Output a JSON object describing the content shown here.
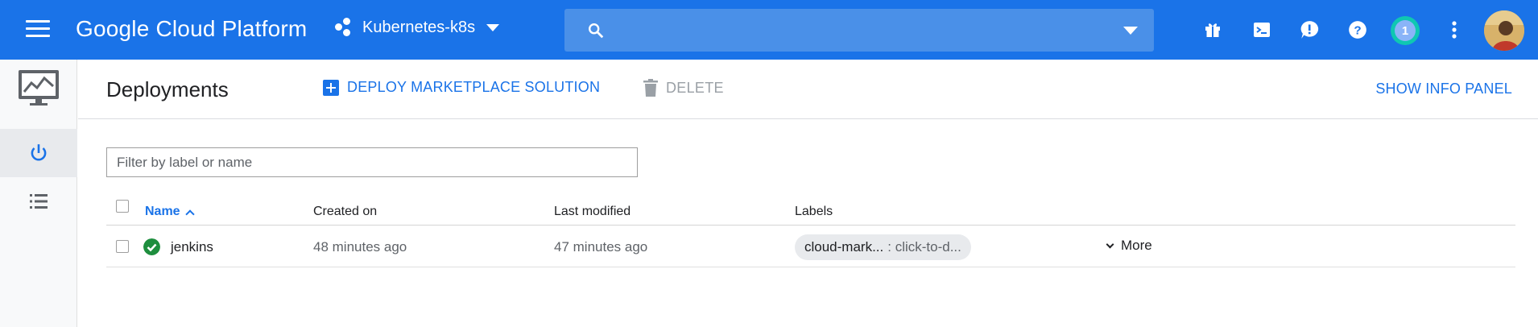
{
  "topbar": {
    "brand": "Google Cloud Platform",
    "project": "Kubernetes-k8s",
    "search_placeholder": "",
    "notification_count": "1",
    "icons": [
      "menu-icon",
      "gift-icon",
      "cloud-shell-icon",
      "feedback-icon",
      "help-icon",
      "more-vert-icon"
    ]
  },
  "rail": {
    "items": [
      "deployments-icon",
      "list-icon"
    ]
  },
  "header": {
    "title": "Deployments",
    "deploy_label": "DEPLOY MARKETPLACE SOLUTION",
    "delete_label": "DELETE",
    "info_panel_label": "SHOW INFO PANEL"
  },
  "filter": {
    "placeholder": "Filter by label or name"
  },
  "table": {
    "columns": [
      "Name",
      "Created on",
      "Last modified",
      "Labels"
    ],
    "rows": [
      {
        "name": "jenkins",
        "status": "ok",
        "created": "48 minutes ago",
        "modified": "47 minutes ago",
        "label_key": "cloud-mark...",
        "label_value": ": click-to-d...",
        "more_label": "More"
      }
    ]
  },
  "colors": {
    "primary": "#1a73e8",
    "status_ok": "#1e8e3e"
  }
}
